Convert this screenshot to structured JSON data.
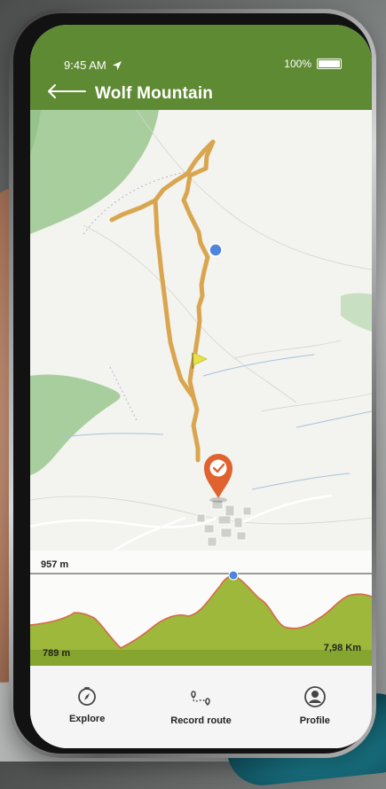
{
  "status_bar": {
    "time": "9:45 AM",
    "battery": "100%"
  },
  "header": {
    "title": "Wolf Mountain"
  },
  "map": {
    "markers": {
      "current_position_color": "#4f84de",
      "destination_color": "#e0622f",
      "flag_color": "#e8e24a"
    },
    "route_color": "#d9a64f"
  },
  "elevation_profile": {
    "max_label": "957 m",
    "min_label": "789 m",
    "distance_label": "7,98 Km",
    "fill_color": "#9db83a",
    "line_color": "#d9674b"
  },
  "nav": {
    "items": [
      {
        "label": "Explore",
        "icon": "compass-icon"
      },
      {
        "label": "Record route",
        "icon": "route-icon"
      },
      {
        "label": "Profile",
        "icon": "user-icon"
      }
    ]
  },
  "colors": {
    "header": "#5e8a33"
  }
}
